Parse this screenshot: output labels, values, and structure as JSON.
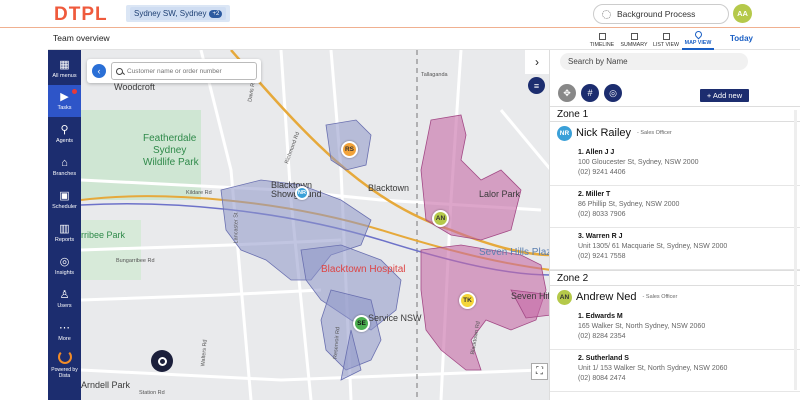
{
  "app": {
    "logo": "DTPL"
  },
  "header": {
    "location_chip": "Sydney SW, Sydney",
    "location_badge": "+2",
    "background_process": "Background Process",
    "user_initials": "AA"
  },
  "subheader": {
    "title": "Team overview",
    "views": [
      {
        "label": "TIMELINE",
        "active": false
      },
      {
        "label": "SUMMARY",
        "active": false
      },
      {
        "label": "LIST VIEW",
        "active": false
      },
      {
        "label": "MAP VIEW",
        "active": true
      }
    ],
    "today": "Today"
  },
  "sidebar": {
    "items": [
      {
        "label": "All menus",
        "icon": "grid-icon"
      },
      {
        "label": "Tasks",
        "icon": "play-icon",
        "active": true
      },
      {
        "label": "Agents",
        "icon": "person-walk-icon"
      },
      {
        "label": "Branches",
        "icon": "store-icon"
      },
      {
        "label": "Scheduler",
        "icon": "calendar-icon"
      },
      {
        "label": "Reports",
        "icon": "bar-chart-icon"
      },
      {
        "label": "Insights",
        "icon": "insights-icon"
      },
      {
        "label": "Users",
        "icon": "user-icon"
      },
      {
        "label": "More",
        "icon": "more-icon"
      }
    ],
    "powered_line1": "Powered by",
    "powered_line2": "Dista"
  },
  "map": {
    "search_placeholder": "Customer name or order number",
    "labels": {
      "woodcroft": "Woodcroft",
      "featherdale": "Featherdale",
      "sydney": "Sydney",
      "wildlife_park": "Wildlife Park",
      "rribee_park": "rribee Park",
      "blacktown_showground": "Blacktown Showground",
      "blacktown": "Blacktown",
      "blacktown_hospital": "Blacktown Hospital",
      "seven_hills_plaza": "Seven Hills Plaza",
      "seven_hills": "Seven Hills",
      "lalor_park": "Lalor Park",
      "service_nsw": "Service NSW",
      "ardell_park": "Arndell Park",
      "kildare_rd": "Kildare Rd",
      "lancaster_st": "Lancaster St",
      "bungarribee_rd": "Bungarribee Rd",
      "richmond_rd": "Richmond Rd",
      "walters_rd": "Walters Rd",
      "reservoir_rd": "Reservoir Rd",
      "lance_cres": "Lance Cres",
      "power_st": "Power St",
      "rugby_st": "Rugby St",
      "davis_rd": "Davis Rd",
      "reid_st": "Reid St",
      "tallaganda": "Tallaganda",
      "bungarribee_rd2": "Bungarribee Rd",
      "blacktown_rd": "Blacktown Rd",
      "hall_st": "Hall St",
      "goodyear": "Goodyear",
      "station_rd": "Station Rd",
      "jolley_rd": "Jolley Rd"
    },
    "pins": [
      {
        "text": "RS",
        "color": "#f2a33a"
      },
      {
        "text": "NR",
        "color": "#3aa0d8"
      },
      {
        "text": "AN",
        "color": "#b5c94a"
      },
      {
        "text": "TK",
        "color": "#f5d63a"
      },
      {
        "text": "SE",
        "color": "#4caf50"
      }
    ]
  },
  "panel": {
    "search_placeholder": "Search by Name",
    "add_new": "+ Add new",
    "zones": [
      {
        "name": "Zone 1",
        "officer": {
          "initials": "NR",
          "name": "Nick Railey",
          "role": "- Sales Officer",
          "color": "#3aa0d8"
        },
        "customers": [
          {
            "name": "1. Allen J J",
            "address": "100 Gloucester St, Sydney, NSW 2000",
            "phone": "(02) 9241 4406"
          },
          {
            "name": "2. Miller T",
            "address": "86 Phillip St, Sydney, NSW 2000",
            "phone": "(02) 8033 7906"
          },
          {
            "name": "3. Warren R J",
            "address": "Unit 1305/ 61 Macquarie St, Sydney, NSW 2000",
            "phone": "(02) 9241 7558"
          }
        ]
      },
      {
        "name": "Zone 2",
        "officer": {
          "initials": "AN",
          "name": "Andrew Ned",
          "role": "- Sales Officer",
          "color": "#b5c94a"
        },
        "customers": [
          {
            "name": "1. Edwards M",
            "address": "165 Walker St, North Sydney, NSW 2060",
            "phone": "(02) 8284 2354"
          },
          {
            "name": "2. Sutherland S",
            "address": "Unit 1/ 153 Walker St, North Sydney, NSW 2060",
            "phone": "(02) 8084 2474"
          }
        ]
      }
    ]
  },
  "colors": {
    "accent": "#1c2d6f",
    "brand": "#ef5a3c",
    "active": "#2e55c8",
    "zone_blue": "#8e95c9",
    "zone_pink": "#c76aa7"
  }
}
